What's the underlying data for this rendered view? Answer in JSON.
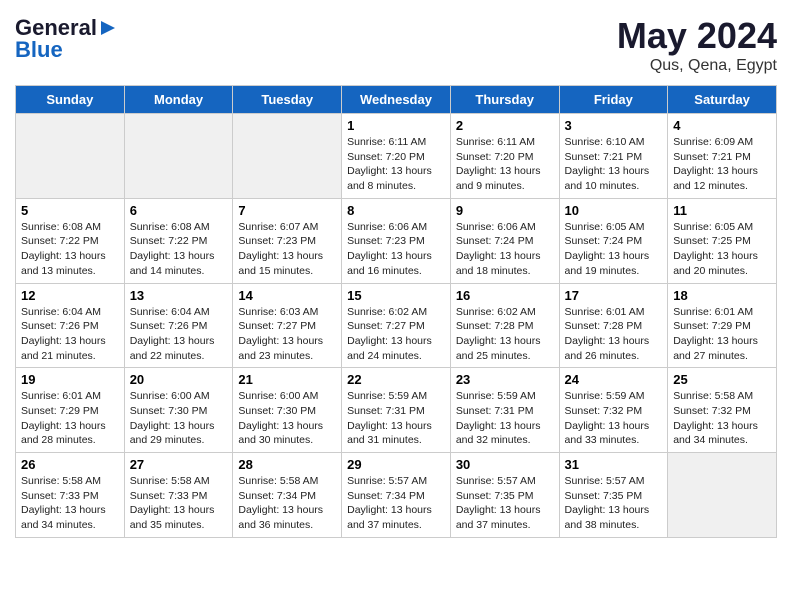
{
  "header": {
    "logo_general": "General",
    "logo_blue": "Blue",
    "title": "May 2024",
    "subtitle": "Qus, Qena, Egypt"
  },
  "weekdays": [
    "Sunday",
    "Monday",
    "Tuesday",
    "Wednesday",
    "Thursday",
    "Friday",
    "Saturday"
  ],
  "weeks": [
    [
      {
        "day": "",
        "empty": true
      },
      {
        "day": "",
        "empty": true
      },
      {
        "day": "",
        "empty": true
      },
      {
        "day": "1",
        "sunrise": "6:11 AM",
        "sunset": "7:20 PM",
        "daylight": "13 hours and 8 minutes."
      },
      {
        "day": "2",
        "sunrise": "6:11 AM",
        "sunset": "7:20 PM",
        "daylight": "13 hours and 9 minutes."
      },
      {
        "day": "3",
        "sunrise": "6:10 AM",
        "sunset": "7:21 PM",
        "daylight": "13 hours and 10 minutes."
      },
      {
        "day": "4",
        "sunrise": "6:09 AM",
        "sunset": "7:21 PM",
        "daylight": "13 hours and 12 minutes."
      }
    ],
    [
      {
        "day": "5",
        "sunrise": "6:08 AM",
        "sunset": "7:22 PM",
        "daylight": "13 hours and 13 minutes."
      },
      {
        "day": "6",
        "sunrise": "6:08 AM",
        "sunset": "7:22 PM",
        "daylight": "13 hours and 14 minutes."
      },
      {
        "day": "7",
        "sunrise": "6:07 AM",
        "sunset": "7:23 PM",
        "daylight": "13 hours and 15 minutes."
      },
      {
        "day": "8",
        "sunrise": "6:06 AM",
        "sunset": "7:23 PM",
        "daylight": "13 hours and 16 minutes."
      },
      {
        "day": "9",
        "sunrise": "6:06 AM",
        "sunset": "7:24 PM",
        "daylight": "13 hours and 18 minutes."
      },
      {
        "day": "10",
        "sunrise": "6:05 AM",
        "sunset": "7:24 PM",
        "daylight": "13 hours and 19 minutes."
      },
      {
        "day": "11",
        "sunrise": "6:05 AM",
        "sunset": "7:25 PM",
        "daylight": "13 hours and 20 minutes."
      }
    ],
    [
      {
        "day": "12",
        "sunrise": "6:04 AM",
        "sunset": "7:26 PM",
        "daylight": "13 hours and 21 minutes."
      },
      {
        "day": "13",
        "sunrise": "6:04 AM",
        "sunset": "7:26 PM",
        "daylight": "13 hours and 22 minutes."
      },
      {
        "day": "14",
        "sunrise": "6:03 AM",
        "sunset": "7:27 PM",
        "daylight": "13 hours and 23 minutes."
      },
      {
        "day": "15",
        "sunrise": "6:02 AM",
        "sunset": "7:27 PM",
        "daylight": "13 hours and 24 minutes."
      },
      {
        "day": "16",
        "sunrise": "6:02 AM",
        "sunset": "7:28 PM",
        "daylight": "13 hours and 25 minutes."
      },
      {
        "day": "17",
        "sunrise": "6:01 AM",
        "sunset": "7:28 PM",
        "daylight": "13 hours and 26 minutes."
      },
      {
        "day": "18",
        "sunrise": "6:01 AM",
        "sunset": "7:29 PM",
        "daylight": "13 hours and 27 minutes."
      }
    ],
    [
      {
        "day": "19",
        "sunrise": "6:01 AM",
        "sunset": "7:29 PM",
        "daylight": "13 hours and 28 minutes."
      },
      {
        "day": "20",
        "sunrise": "6:00 AM",
        "sunset": "7:30 PM",
        "daylight": "13 hours and 29 minutes."
      },
      {
        "day": "21",
        "sunrise": "6:00 AM",
        "sunset": "7:30 PM",
        "daylight": "13 hours and 30 minutes."
      },
      {
        "day": "22",
        "sunrise": "5:59 AM",
        "sunset": "7:31 PM",
        "daylight": "13 hours and 31 minutes."
      },
      {
        "day": "23",
        "sunrise": "5:59 AM",
        "sunset": "7:31 PM",
        "daylight": "13 hours and 32 minutes."
      },
      {
        "day": "24",
        "sunrise": "5:59 AM",
        "sunset": "7:32 PM",
        "daylight": "13 hours and 33 minutes."
      },
      {
        "day": "25",
        "sunrise": "5:58 AM",
        "sunset": "7:32 PM",
        "daylight": "13 hours and 34 minutes."
      }
    ],
    [
      {
        "day": "26",
        "sunrise": "5:58 AM",
        "sunset": "7:33 PM",
        "daylight": "13 hours and 34 minutes."
      },
      {
        "day": "27",
        "sunrise": "5:58 AM",
        "sunset": "7:33 PM",
        "daylight": "13 hours and 35 minutes."
      },
      {
        "day": "28",
        "sunrise": "5:58 AM",
        "sunset": "7:34 PM",
        "daylight": "13 hours and 36 minutes."
      },
      {
        "day": "29",
        "sunrise": "5:57 AM",
        "sunset": "7:34 PM",
        "daylight": "13 hours and 37 minutes."
      },
      {
        "day": "30",
        "sunrise": "5:57 AM",
        "sunset": "7:35 PM",
        "daylight": "13 hours and 37 minutes."
      },
      {
        "day": "31",
        "sunrise": "5:57 AM",
        "sunset": "7:35 PM",
        "daylight": "13 hours and 38 minutes."
      },
      {
        "day": "",
        "empty": true
      }
    ]
  ],
  "labels": {
    "sunrise": "Sunrise:",
    "sunset": "Sunset:",
    "daylight": "Daylight hours"
  }
}
